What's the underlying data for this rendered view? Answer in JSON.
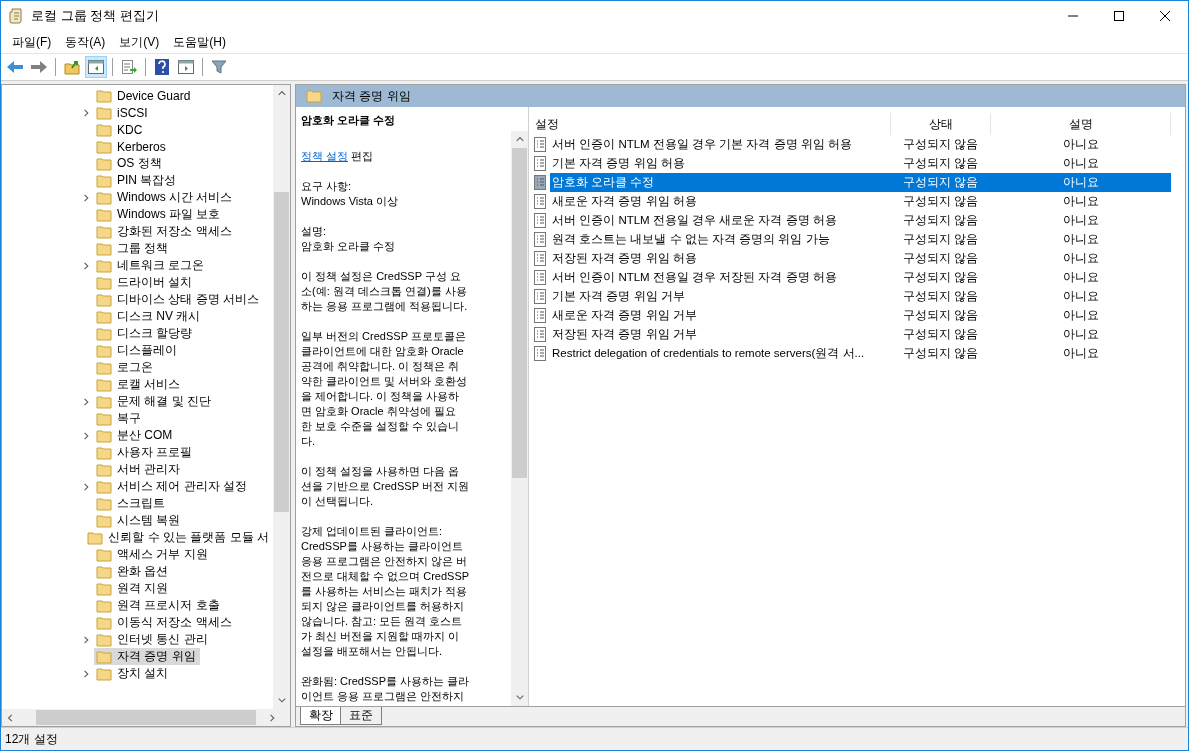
{
  "window": {
    "title": "로컬 그룹 정책 편집기"
  },
  "menu": [
    "파일(F)",
    "동작(A)",
    "보기(V)",
    "도움말(H)"
  ],
  "toolbar": [
    {
      "kind": "back",
      "pressed": false
    },
    {
      "kind": "forward",
      "pressed": false
    },
    {
      "kind": "sep"
    },
    {
      "kind": "up",
      "pressed": false
    },
    {
      "kind": "tree",
      "pressed": true
    },
    {
      "kind": "sep"
    },
    {
      "kind": "export",
      "pressed": false
    },
    {
      "kind": "sep"
    },
    {
      "kind": "help",
      "pressed": false
    },
    {
      "kind": "pane",
      "pressed": false
    },
    {
      "kind": "sep"
    },
    {
      "kind": "filter",
      "pressed": false
    }
  ],
  "tree": [
    {
      "label": "Device Guard",
      "expandable": false,
      "selected": false
    },
    {
      "label": "iSCSI",
      "expandable": true,
      "selected": false
    },
    {
      "label": "KDC",
      "expandable": false,
      "selected": false
    },
    {
      "label": "Kerberos",
      "expandable": false,
      "selected": false
    },
    {
      "label": "OS 정책",
      "expandable": false,
      "selected": false
    },
    {
      "label": "PIN 복잡성",
      "expandable": false,
      "selected": false
    },
    {
      "label": "Windows 시간 서비스",
      "expandable": true,
      "selected": false
    },
    {
      "label": "Windows 파일 보호",
      "expandable": false,
      "selected": false
    },
    {
      "label": "강화된 저장소 액세스",
      "expandable": false,
      "selected": false
    },
    {
      "label": "그룹 정책",
      "expandable": false,
      "selected": false
    },
    {
      "label": "네트워크 로그온",
      "expandable": true,
      "selected": false
    },
    {
      "label": "드라이버 설치",
      "expandable": false,
      "selected": false
    },
    {
      "label": "디바이스 상태 증명 서비스",
      "expandable": false,
      "selected": false
    },
    {
      "label": "디스크 NV 캐시",
      "expandable": false,
      "selected": false
    },
    {
      "label": "디스크 할당량",
      "expandable": false,
      "selected": false
    },
    {
      "label": "디스플레이",
      "expandable": false,
      "selected": false
    },
    {
      "label": "로그온",
      "expandable": false,
      "selected": false
    },
    {
      "label": "로캘 서비스",
      "expandable": false,
      "selected": false
    },
    {
      "label": "문제 해결 및 진단",
      "expandable": true,
      "selected": false
    },
    {
      "label": "복구",
      "expandable": false,
      "selected": false
    },
    {
      "label": "분산 COM",
      "expandable": true,
      "selected": false
    },
    {
      "label": "사용자 프로필",
      "expandable": false,
      "selected": false
    },
    {
      "label": "서버 관리자",
      "expandable": false,
      "selected": false
    },
    {
      "label": "서비스 제어 관리자 설정",
      "expandable": true,
      "selected": false
    },
    {
      "label": "스크립트",
      "expandable": false,
      "selected": false
    },
    {
      "label": "시스템 복원",
      "expandable": false,
      "selected": false
    },
    {
      "label": "신뢰할 수 있는 플랫폼 모듈 서",
      "expandable": false,
      "selected": false
    },
    {
      "label": "액세스 거부 지원",
      "expandable": false,
      "selected": false
    },
    {
      "label": "완화 옵션",
      "expandable": false,
      "selected": false
    },
    {
      "label": "원격 지원",
      "expandable": false,
      "selected": false
    },
    {
      "label": "원격 프로시저 호출",
      "expandable": false,
      "selected": false
    },
    {
      "label": "이동식 저장소 액세스",
      "expandable": false,
      "selected": false
    },
    {
      "label": "인터넷 통신 관리",
      "expandable": true,
      "selected": false
    },
    {
      "label": "자격 증명 위임",
      "expandable": false,
      "selected": true
    },
    {
      "label": "장치 설치",
      "expandable": true,
      "selected": false
    }
  ],
  "pane_header": "자격 증명 위임",
  "description": {
    "title": "암호화 오라클 수정",
    "link": "정책 설정",
    "link_suffix": "편집",
    "paragraphs": [
      [
        "요구 사항:",
        "Windows Vista 이상"
      ],
      [
        "설명:",
        "암호화 오라클 수정"
      ],
      [
        "이 정책 설정은 CredSSP 구성 요",
        "소(예: 원격 데스크톱 연결)를 사용",
        "하는 응용 프로그램에 적용됩니다."
      ],
      [
        "일부 버전의 CredSSP 프로토콜은",
        "클라이언트에 대한 암호화 Oracle",
        "공격에 취약합니다.  이 정책은 취",
        "약한 클라이언트 및 서버와 호환성",
        "을 제어합니다.  이 정책을 사용하",
        "면 암호화 Oracle 취약성에 필요",
        "한 보호 수준을 설정할 수 있습니",
        "다."
      ],
      [
        "이 정책 설정을 사용하면 다음 옵",
        "션을 기반으로 CredSSP 버전 지원",
        "이 선택됩니다."
      ],
      [
        "강제 업데이트된 클라이언트:",
        "CredSSP를 사용하는 클라이언트",
        "응용 프로그램은 안전하지 않은 버",
        "전으로 대체할 수 없으며 CredSSP",
        "를 사용하는 서비스는 패치가 적용",
        "되지 않은 클라이언트를 허용하지",
        "않습니다. 참고: 모든 원격 호스트",
        "가 최신 버전을 지원할 때까지 이",
        "설정을 배포해서는 안됩니다."
      ],
      [
        "완화됨: CredSSP를 사용하는 클라",
        "이언트 응용 프로그램은 안전하지"
      ]
    ]
  },
  "columns": [
    "설정",
    "상태",
    "설명"
  ],
  "rows": [
    {
      "name": "서버 인증이 NTLM 전용일 경우 기본 자격 증명 위임 허용",
      "state": "구성되지 않음",
      "comment": "아니요",
      "selected": false
    },
    {
      "name": "기본 자격 증명 위임 허용",
      "state": "구성되지 않음",
      "comment": "아니요",
      "selected": false
    },
    {
      "name": "암호화 오라클 수정",
      "state": "구성되지 않음",
      "comment": "아니요",
      "selected": true
    },
    {
      "name": "새로운 자격 증명 위임 허용",
      "state": "구성되지 않음",
      "comment": "아니요",
      "selected": false
    },
    {
      "name": "서버 인증이 NTLM 전용일 경우 새로운 자격 증명 허용",
      "state": "구성되지 않음",
      "comment": "아니요",
      "selected": false
    },
    {
      "name": "원격 호스트는 내보낼 수 없는 자격 증명의 위임 가능",
      "state": "구성되지 않음",
      "comment": "아니요",
      "selected": false
    },
    {
      "name": "저장된 자격 증명 위임 허용",
      "state": "구성되지 않음",
      "comment": "아니요",
      "selected": false
    },
    {
      "name": "서버 인증이 NTLM 전용일 경우 저장된 자격 증명 허용",
      "state": "구성되지 않음",
      "comment": "아니요",
      "selected": false
    },
    {
      "name": "기본 자격 증명 위임 거부",
      "state": "구성되지 않음",
      "comment": "아니요",
      "selected": false
    },
    {
      "name": "새로운 자격 증명 위임 거부",
      "state": "구성되지 않음",
      "comment": "아니요",
      "selected": false
    },
    {
      "name": "저장된 자격 증명 위임 거부",
      "state": "구성되지 않음",
      "comment": "아니요",
      "selected": false
    },
    {
      "name": "Restrict delegation of credentials to remote servers(원격 서...",
      "state": "구성되지 않음",
      "comment": "아니요",
      "selected": false
    }
  ],
  "view_tabs": [
    {
      "label": "확장",
      "selected": true
    },
    {
      "label": "표준",
      "selected": false
    }
  ],
  "status_bar": "12개 설정"
}
